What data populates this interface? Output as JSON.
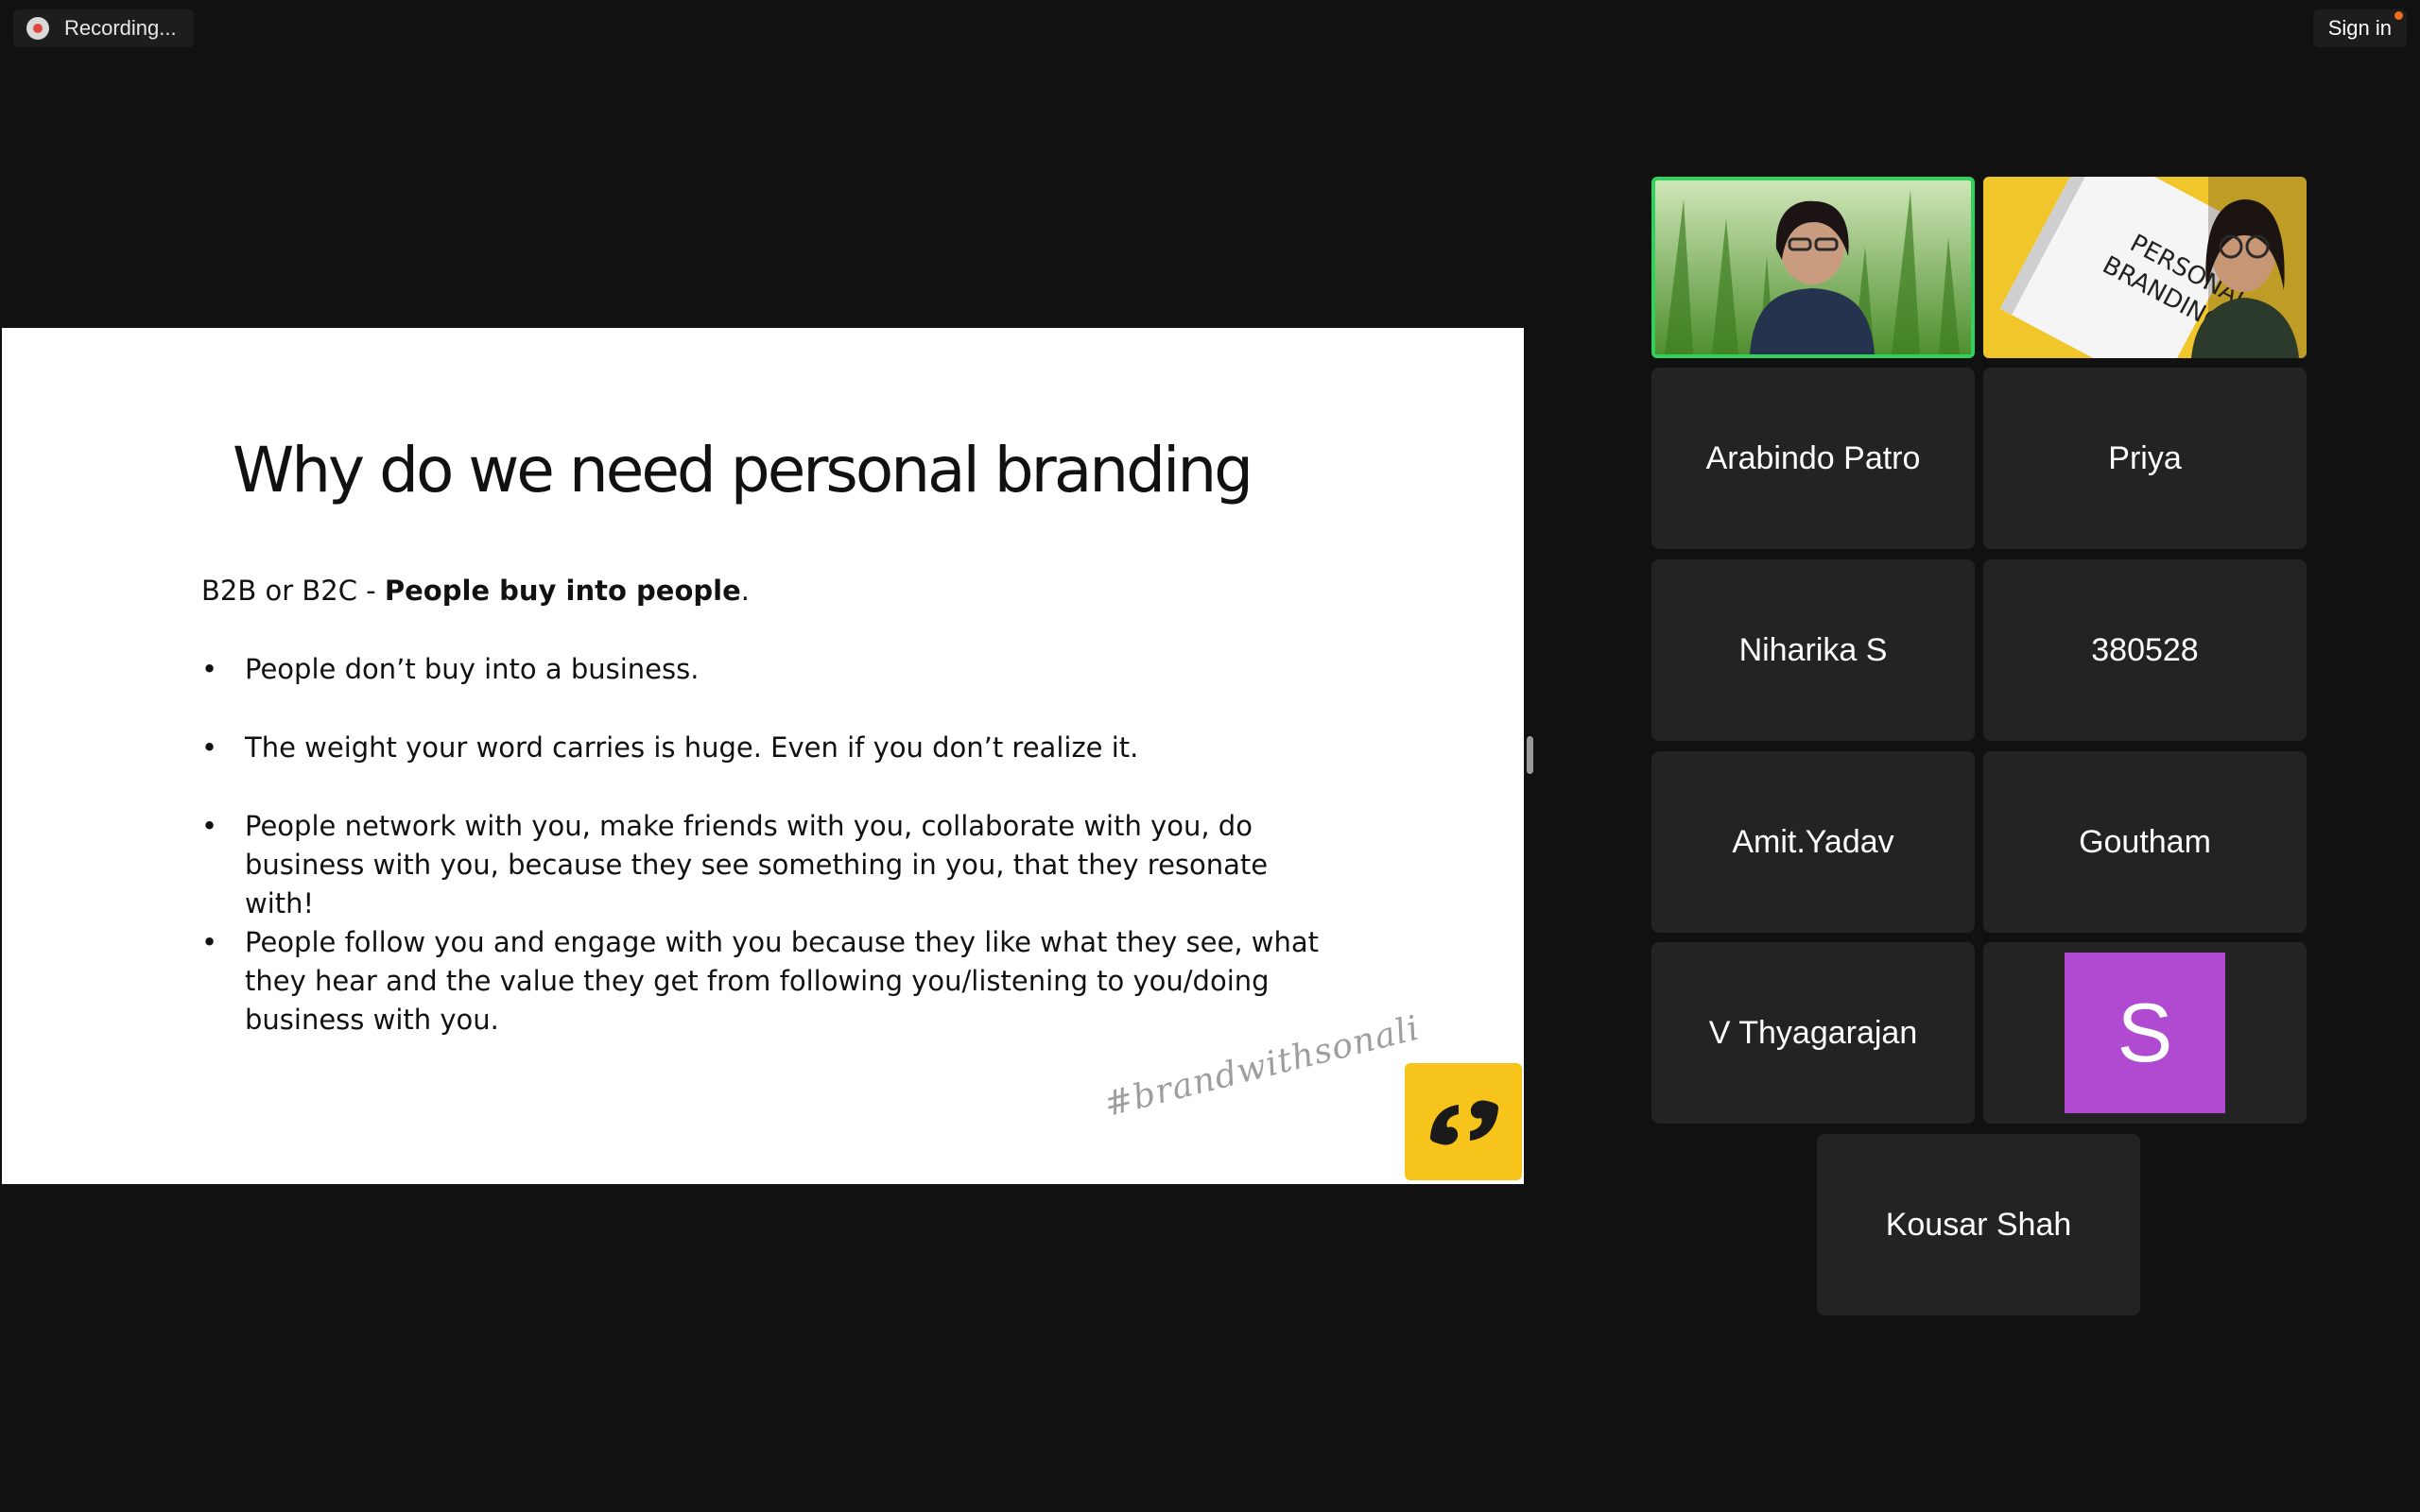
{
  "top_bar": {
    "recording_label": "Recording...",
    "signin_label": "Sign in"
  },
  "slide": {
    "title": "Why do we need personal branding",
    "intro_plain": "B2B or B2C - ",
    "intro_bold": "People buy into people",
    "intro_end": ".",
    "bullets": [
      "People don’t buy into a business.",
      "The weight your word carries is huge. Even if you don’t realize it.",
      "People network with you, make friends with you, collaborate with you, do business with you, because they see something in you, that they resonate with!",
      "People follow you and engage with you because they like what they see, what they hear and the value they get from following you/listening to you/doing business with you."
    ],
    "hashtag": "#brandwithsonali",
    "notebook_text": "PERSONAL BRANDING"
  },
  "participants": [
    {
      "name": "Arabindo Patro"
    },
    {
      "name": "Priya"
    },
    {
      "name": "Niharika S"
    },
    {
      "name": "380528"
    },
    {
      "name": "Amit.Yadav"
    },
    {
      "name": "Goutham"
    },
    {
      "name": "V Thyagarajan"
    },
    {
      "name": "Kousar Shah"
    }
  ],
  "avatar_initial": "S",
  "colors": {
    "background": "#111111",
    "tile": "#232323",
    "active_speaker": "#2fd35b",
    "avatar": "#b04ad0",
    "logo": "#f7c41b",
    "recording_dot": "#e0463d"
  }
}
